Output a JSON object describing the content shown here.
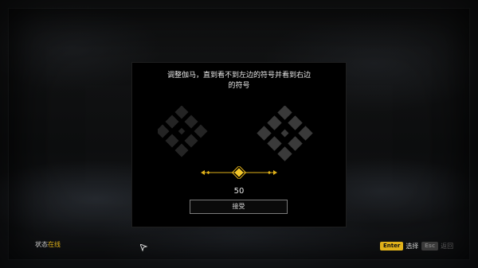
{
  "dialog": {
    "prompt": "调整伽马，直到看不到左边的符号并看到右边\n的符号",
    "value": "50",
    "accept_label": "接受",
    "gamma_level_percent": 50
  },
  "footer": {
    "status_label": "状态",
    "status_value": "在线",
    "select_key": "Enter",
    "select_label": "选择",
    "back_key": "Esc",
    "back_label": "返回"
  },
  "colors": {
    "accent": "#e0b11a",
    "symbol_left": "#2a2a2a",
    "symbol_right": "#3a3a3a"
  },
  "icons": {
    "left_symbol": "faint-diamond-cluster-icon",
    "right_symbol": "visible-diamond-cluster-icon",
    "cursor": "arrow-cursor-icon"
  }
}
